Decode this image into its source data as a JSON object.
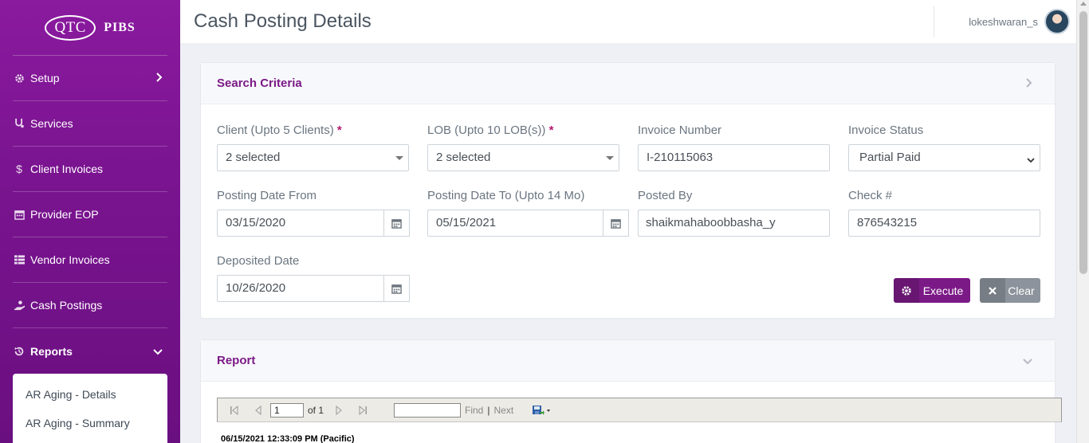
{
  "brand": {
    "logo": "QTC",
    "name": "PIBS"
  },
  "sidebar": {
    "items": [
      {
        "label": "Setup",
        "icon": "gear-icon"
      },
      {
        "label": "Services",
        "icon": "stethoscope-icon"
      },
      {
        "label": "Client Invoices",
        "icon": "dollar-icon"
      },
      {
        "label": "Provider EOP",
        "icon": "calendar-icon"
      },
      {
        "label": "Vendor Invoices",
        "icon": "table-icon"
      },
      {
        "label": "Cash Postings",
        "icon": "hand-coin-icon"
      },
      {
        "label": "Reports",
        "icon": "history-icon"
      }
    ],
    "submenu": [
      "AR Aging - Details",
      "AR Aging - Summary"
    ]
  },
  "header": {
    "title": "Cash Posting Details",
    "user": "lokeshwaran_s"
  },
  "search": {
    "title": "Search Criteria",
    "client": {
      "label": "Client (Upto 5 Clients)",
      "value": "2 selected"
    },
    "lob": {
      "label": "LOB (Upto 10 LOB(s))",
      "value": "2 selected"
    },
    "invoice_number": {
      "label": "Invoice Number",
      "value": "I-210115063"
    },
    "invoice_status": {
      "label": "Invoice Status",
      "value": "Partial Paid"
    },
    "posting_from": {
      "label": "Posting Date From",
      "value": "03/15/2020"
    },
    "posting_to": {
      "label": "Posting Date To (Upto 14 Mo)",
      "value": "05/15/2021"
    },
    "posted_by": {
      "label": "Posted By",
      "value": "shaikmahaboobbasha_y"
    },
    "check": {
      "label": "Check #",
      "value": "876543215"
    },
    "deposited": {
      "label": "Deposited Date",
      "value": "10/26/2020"
    },
    "required_mark": "*",
    "execute": "Execute",
    "clear": "Clear"
  },
  "report": {
    "title": "Report",
    "page": "1",
    "of": "of 1",
    "find": "Find",
    "separator": "|",
    "next": "Next",
    "timestamp": "06/15/2021 12:33:09 PM (Pacific)"
  },
  "colors": {
    "brand": "#7b1a86",
    "sidebar": "#8a1a9e",
    "clear": "#8c939c"
  }
}
